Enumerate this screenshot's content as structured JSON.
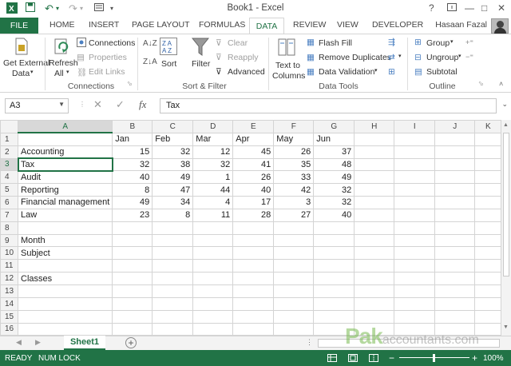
{
  "titlebar": {
    "title": "Book1 - Excel",
    "help": "?",
    "minimize": "—",
    "restore": "□",
    "close": "✕"
  },
  "tabs": {
    "file": "FILE",
    "items": [
      "HOME",
      "INSERT",
      "PAGE LAYOUT",
      "FORMULAS",
      "DATA",
      "REVIEW",
      "VIEW",
      "DEVELOPER"
    ],
    "active": "DATA",
    "user": "Hasaan Fazal"
  },
  "ribbon": {
    "get_external": [
      "Get External",
      "Data"
    ],
    "refresh": [
      "Refresh",
      "All"
    ],
    "connections": "Connections",
    "properties": "Properties",
    "edit_links": "Edit Links",
    "group_connections": "Connections",
    "sort": "Sort",
    "filter": "Filter",
    "clear": "Clear",
    "reapply": "Reapply",
    "advanced": "Advanced",
    "group_sort_filter": "Sort & Filter",
    "text_to_columns": [
      "Text to",
      "Columns"
    ],
    "flash_fill": "Flash Fill",
    "remove_duplicates": "Remove Duplicates",
    "data_validation": "Data Validation",
    "group_data_tools": "Data Tools",
    "group": "Group",
    "ungroup": "Ungroup",
    "subtotal": "Subtotal",
    "group_outline": "Outline"
  },
  "formula_bar": {
    "name_box": "A3",
    "formula": "Tax",
    "fx": "fx"
  },
  "grid": {
    "columns": [
      "A",
      "B",
      "C",
      "D",
      "E",
      "F",
      "G",
      "H",
      "I",
      "J",
      "K"
    ],
    "rows": [
      [
        "",
        "Jan",
        "Feb",
        "Mar",
        "Apr",
        "May",
        "Jun",
        "",
        "",
        "",
        ""
      ],
      [
        "Accounting",
        "15",
        "32",
        "12",
        "45",
        "26",
        "37",
        "",
        "",
        "",
        ""
      ],
      [
        "Tax",
        "32",
        "38",
        "32",
        "41",
        "35",
        "48",
        "",
        "",
        "",
        ""
      ],
      [
        "Audit",
        "40",
        "49",
        "1",
        "26",
        "33",
        "49",
        "",
        "",
        "",
        ""
      ],
      [
        "Reporting",
        "8",
        "47",
        "44",
        "40",
        "42",
        "32",
        "",
        "",
        "",
        ""
      ],
      [
        "Financial management",
        "49",
        "34",
        "4",
        "17",
        "3",
        "32",
        "",
        "",
        "",
        ""
      ],
      [
        "Law",
        "23",
        "8",
        "11",
        "28",
        "27",
        "40",
        "",
        "",
        "",
        ""
      ],
      [
        "",
        "",
        "",
        "",
        "",
        "",
        "",
        "",
        "",
        "",
        ""
      ],
      [
        "Month",
        "",
        "",
        "",
        "",
        "",
        "",
        "",
        "",
        "",
        ""
      ],
      [
        "Subject",
        "",
        "",
        "",
        "",
        "",
        "",
        "",
        "",
        "",
        ""
      ],
      [
        "",
        "",
        "",
        "",
        "",
        "",
        "",
        "",
        "",
        "",
        ""
      ],
      [
        "Classes",
        "",
        "",
        "",
        "",
        "",
        "",
        "",
        "",
        "",
        ""
      ],
      [
        "",
        "",
        "",
        "",
        "",
        "",
        "",
        "",
        "",
        "",
        ""
      ],
      [
        "",
        "",
        "",
        "",
        "",
        "",
        "",
        "",
        "",
        "",
        ""
      ],
      [
        "",
        "",
        "",
        "",
        "",
        "",
        "",
        "",
        "",
        "",
        ""
      ],
      [
        "",
        "",
        "",
        "",
        "",
        "",
        "",
        "",
        "",
        "",
        ""
      ]
    ],
    "selected_row": 3,
    "selected_col": "A"
  },
  "sheets": {
    "active": "Sheet1",
    "add": "+"
  },
  "watermark": {
    "main": "Pak",
    "sub": "accountants.com"
  },
  "statusbar": {
    "ready": "READY",
    "numlock": "NUM LOCK",
    "zoom": "100%",
    "zoom_minus": "−",
    "zoom_plus": "+"
  },
  "colors": {
    "accent": "#217346",
    "header_bg": "#f3f3f3",
    "gridline": "#d4d4d4"
  }
}
